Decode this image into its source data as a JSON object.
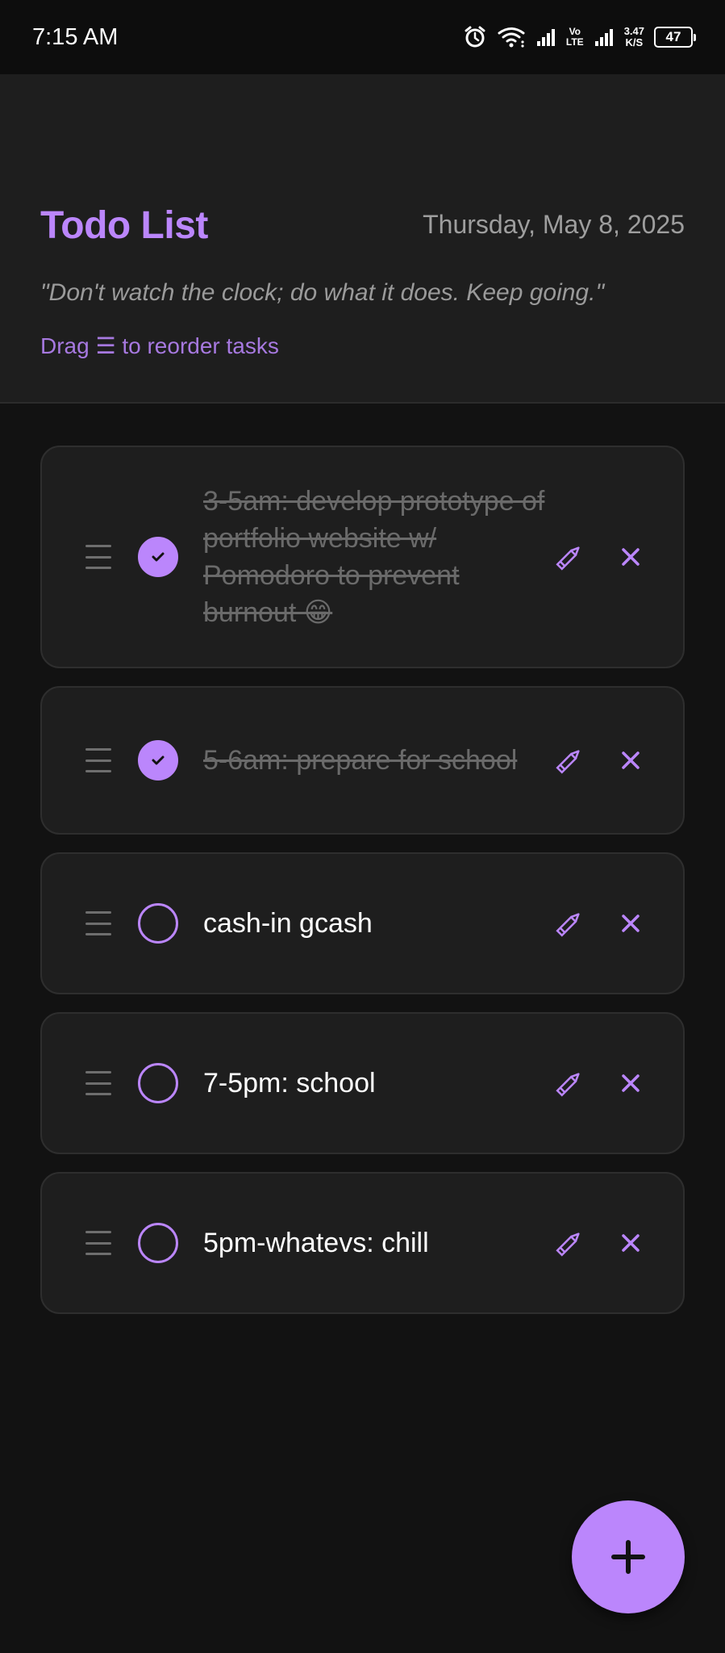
{
  "status_bar": {
    "time": "7:15 AM",
    "volte_top": "Vo",
    "volte_bottom": "LTE",
    "net_speed_value": "3.47",
    "net_speed_unit": "K/S",
    "battery": "47"
  },
  "header": {
    "title": "Todo List",
    "date": "Thursday, May 8, 2025",
    "quote": "\"Don't watch the clock; do what it does. Keep going.\"",
    "hint": "Drag ☰ to reorder tasks"
  },
  "tasks": [
    {
      "text": "3-5am: develop prototype of portfolio website w/ Pomodoro to prevent burnout 😁",
      "done": true
    },
    {
      "text": "5-6am: prepare for school",
      "done": true
    },
    {
      "text": "cash-in gcash",
      "done": false
    },
    {
      "text": "7-5pm: school",
      "done": false
    },
    {
      "text": "5pm-whatevs: chill",
      "done": false
    }
  ],
  "fab": {
    "icon": "plus-icon"
  },
  "icons": {
    "drag": "drag-handle-icon",
    "check": "check-icon",
    "edit": "pencil-icon",
    "delete": "close-icon"
  },
  "colors": {
    "accent": "#bb86fc",
    "background": "#121212",
    "card": "#1e1e1e",
    "done_text": "#6a6a6a"
  }
}
